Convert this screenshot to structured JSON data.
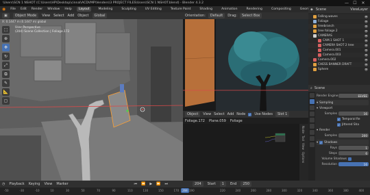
{
  "titlebar": {
    "title": "\\Users\\SCN 1 NSHOT (C:\\Users\\HP\\Desktop\\cinnal\\ACDVMP\\Venders\\3 PROJECT FILES\\Users\\SCN 1 NSHOT.blend) - Blender 4.3.2",
    "minimize": "—",
    "maximize": "☐",
    "close": "✕"
  },
  "menubar": {
    "items": [
      "File",
      "Edit",
      "Render",
      "Window",
      "Help"
    ],
    "workspaces": [
      "Layout",
      "Modeling",
      "Sculpting",
      "UV Editing",
      "Texture Paint",
      "Shading",
      "Animation",
      "Rendering",
      "Compositing",
      "Geometry Nodes",
      "Scripting"
    ],
    "active_workspace": "Layout"
  },
  "viewport": {
    "mode": "Object Mode",
    "menus": [
      "View",
      "Select",
      "Add",
      "Object"
    ],
    "transform": "Global",
    "overlay_line1": "User Perspective",
    "overlay_line2": "(204) Scene Collection | Foliage.172",
    "statusline": "X: 0.1447 m  (0.1447 m) global"
  },
  "render_header": {
    "orientation": "Orientation:",
    "orientation_value": "Default",
    "drag": "Drag:",
    "drag_value": "Select Box"
  },
  "node_editor": {
    "object": "Object",
    "menus": [
      "View",
      "Select",
      "Add",
      "Node"
    ],
    "use_nodes": "Use Nodes",
    "slot": "Slot 1",
    "breadcrumb": [
      "Foliage.172",
      "Plane.059",
      "Foliage"
    ],
    "side_tabs": [
      "Node",
      "Tool",
      "View",
      "Options"
    ]
  },
  "outliner": {
    "header": "Scene",
    "view_layer": "ViewLayer",
    "items": [
      {
        "name": "Falling.waves",
        "color": "#e0a040",
        "indent": 1
      },
      {
        "name": "Foliage",
        "color": "#8fb0d8",
        "indent": 1
      },
      {
        "name": "treebranch",
        "color": "#e0a040",
        "indent": 1
      },
      {
        "name": "tree foliage 2",
        "color": "#e0a040",
        "indent": 1
      },
      {
        "name": "CAMERAS",
        "color": "#cfcfcf",
        "indent": 1
      },
      {
        "name": "CAM.1 SHOT 1",
        "color": "#d86060",
        "indent": 2
      },
      {
        "name": "CAMERA SHOT 2 tree",
        "color": "#d86060",
        "indent": 2
      },
      {
        "name": "Camera.001",
        "color": "#d86060",
        "indent": 2
      },
      {
        "name": "Camera.003",
        "color": "#d86060",
        "indent": 2
      },
      {
        "name": "Camera.002",
        "color": "#d86060",
        "indent": 1
      },
      {
        "name": "CHESS BANNER DRAFT",
        "color": "#e0a040",
        "indent": 1
      },
      {
        "name": "Sphere",
        "color": "#e0a040",
        "indent": 1
      }
    ]
  },
  "properties": {
    "header": "Scene",
    "render_engine_label": "Render Engine",
    "render_engine_value": "EEVEE",
    "sampling": "Sampling",
    "viewport": "Viewport",
    "samples_label": "Samples",
    "viewport_samples": "16",
    "temporal": "Temporal Re",
    "jittered": "Jittered Sha",
    "render": "Render",
    "render_samples": "200",
    "shadows": "Shadows",
    "rays_label": "Rays",
    "rays": "1",
    "steps_label": "Steps",
    "steps": "6",
    "volume_shadows_label": "Volume Shadows",
    "resolution_label": "Resolution",
    "resolution": "16"
  },
  "timeline": {
    "menus": [
      "Playback",
      "Keying",
      "View",
      "Marker"
    ],
    "current_frame": "204",
    "start_label": "Start",
    "start": "1",
    "end_label": "End",
    "end": "250",
    "ticks": [
      "-50",
      "-30",
      "-10",
      "10",
      "30",
      "50",
      "70",
      "90",
      "110",
      "130",
      "150",
      "170",
      "190",
      "204",
      "220",
      "240",
      "260",
      "280",
      "300",
      "320",
      "340",
      "360",
      "380",
      "400"
    ]
  },
  "colors": {
    "accent": "#4772b3",
    "axis_red": "#d94a4a",
    "wall_orange": "#b8703a",
    "foliage_teal": "#2f7a82"
  }
}
